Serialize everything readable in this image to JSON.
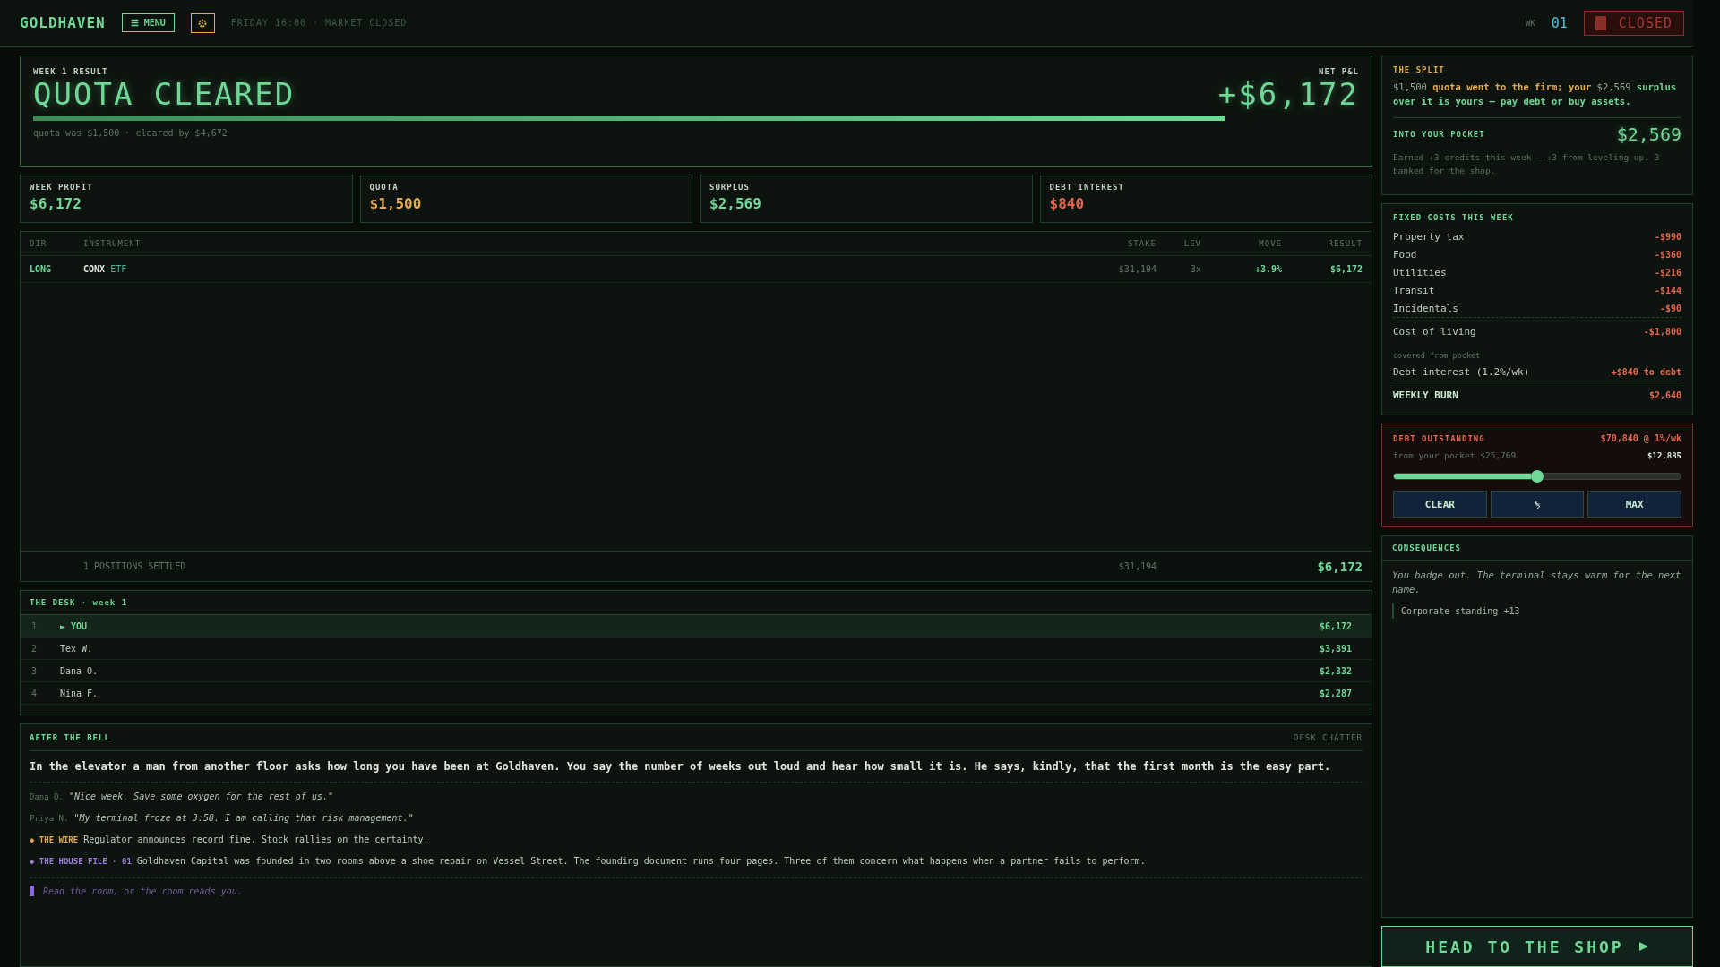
{
  "topbar": {
    "brand": "GOLDHAVEN",
    "menu": "☰ MENU",
    "status": "FRIDAY 16:00 · MARKET CLOSED",
    "week_label": "WK",
    "week": "01",
    "market": "CLOSED"
  },
  "result": {
    "label": "WEEK 1 RESULT",
    "title": "QUOTA CLEARED",
    "level": 1,
    "note": "quota was $1,500 · cleared by $4,672",
    "pnl_label": "NET P&L",
    "pnl": "+$6,172"
  },
  "stats": [
    {
      "label": "WEEK PROFIT",
      "value": "$6,172",
      "color": "#6fd896"
    },
    {
      "label": "QUOTA",
      "value": "$1,500",
      "color": "#e3a94c"
    },
    {
      "label": "SURPLUS",
      "value": "$2,569",
      "color": "#6fd896"
    },
    {
      "label": "DEBT INTEREST",
      "value": "$840",
      "color": "#e4654f"
    }
  ],
  "positions": {
    "columns": [
      "DIR",
      "INSTRUMENT",
      "STAKE",
      "LEV",
      "MOVE",
      "RESULT"
    ],
    "rows": [
      {
        "dir": "LONG",
        "ticker": "CONX",
        "type": "ETF",
        "stake": "$31,194",
        "lev": "3x",
        "move": "+3.9%",
        "result": "$6,172"
      }
    ],
    "footer": {
      "label": "1 POSITIONS SETTLED",
      "stake": "$31,194",
      "result": "$6,172"
    }
  },
  "desk": {
    "title": "THE DESK · week 1",
    "rows": [
      {
        "rank": "1",
        "name": "► YOU",
        "amount": "$6,172",
        "selected": true
      },
      {
        "rank": "2",
        "name": "Tex W.",
        "amount": "$3,391",
        "selected": false
      },
      {
        "rank": "3",
        "name": "Dana O.",
        "amount": "$2,332",
        "selected": false
      },
      {
        "rank": "4",
        "name": "Nina F.",
        "amount": "$2,287",
        "selected": false
      }
    ]
  },
  "bell": {
    "title": "AFTER THE BELL",
    "tag": "DESK CHATTER",
    "lead": "In the elevator a man from another floor asks how long you have been at Goldhaven. You say the number of weeks out loud and hear how small it is. He says, kindly, that the first month is the easy part.",
    "chatter": [
      {
        "speaker": "Dana O.",
        "quote": "\"Nice week. Save some oxygen for the rest of us.\""
      },
      {
        "speaker": "Priya N.",
        "quote": "\"My terminal froze at 3:58. I am calling that risk management.\""
      }
    ],
    "news": [
      {
        "kind": "wire",
        "marker": "◆",
        "source": "THE WIRE",
        "text": "Regulator announces record fine. Stock rallies on the certainty."
      },
      {
        "kind": "house",
        "marker": "◆",
        "source": "THE HOUSE FILE · 01",
        "text": "Goldhaven Capital was founded in two rooms above a shoe repair on Vessel Street. The founding document runs four pages. Three of them concern what happens when a partner fails to perform."
      }
    ],
    "prompt": "Read the room, or the room reads you."
  },
  "split": {
    "title": "THE SPLIT",
    "parts": [
      {
        "kind": "plain",
        "text": "$1,500 "
      },
      {
        "kind": "amber",
        "text": "quota went to the firm; your "
      },
      {
        "kind": "plain",
        "text": "$2,569 "
      },
      {
        "kind": "green",
        "text": "surplus over it is yours — pay debt or buy assets."
      }
    ],
    "pocket_label": "INTO YOUR POCKET",
    "pocket": "$2,569",
    "credits": "Earned +3 credits this week — +3 from leveling up. 3 banked for the shop."
  },
  "costs": {
    "title": "FIXED COSTS THIS WEEK",
    "items": [
      {
        "label": "Property tax",
        "amount": "-$990"
      },
      {
        "label": "Food",
        "amount": "-$360"
      },
      {
        "label": "Utilities",
        "amount": "-$216"
      },
      {
        "label": "Transit",
        "amount": "-$144"
      },
      {
        "label": "Incidentals",
        "amount": "-$90"
      }
    ],
    "total": {
      "label": "Cost of living",
      "amount": "-$1,800"
    },
    "covered": "covered from pocket",
    "interest": {
      "label": "Debt interest (1.2%/wk)",
      "amount": "+$840 to debt"
    },
    "burn": {
      "label": "WEEKLY BURN",
      "amount": "$2,640"
    }
  },
  "debt": {
    "title": "DEBT OUTSTANDING",
    "amount": "$70,840 @ 1%/wk",
    "pocket_note": "from your pocket $25,769",
    "payment": "$12,885",
    "level": 0.5,
    "buttons": [
      "CLEAR",
      "½",
      "MAX"
    ]
  },
  "consequences": {
    "title": "CONSEQUENCES",
    "text": "You badge out. The terminal stays warm for the next name.",
    "effects": [
      "Corporate standing +13"
    ]
  },
  "shop": {
    "label": "HEAD TO THE SHOP"
  }
}
